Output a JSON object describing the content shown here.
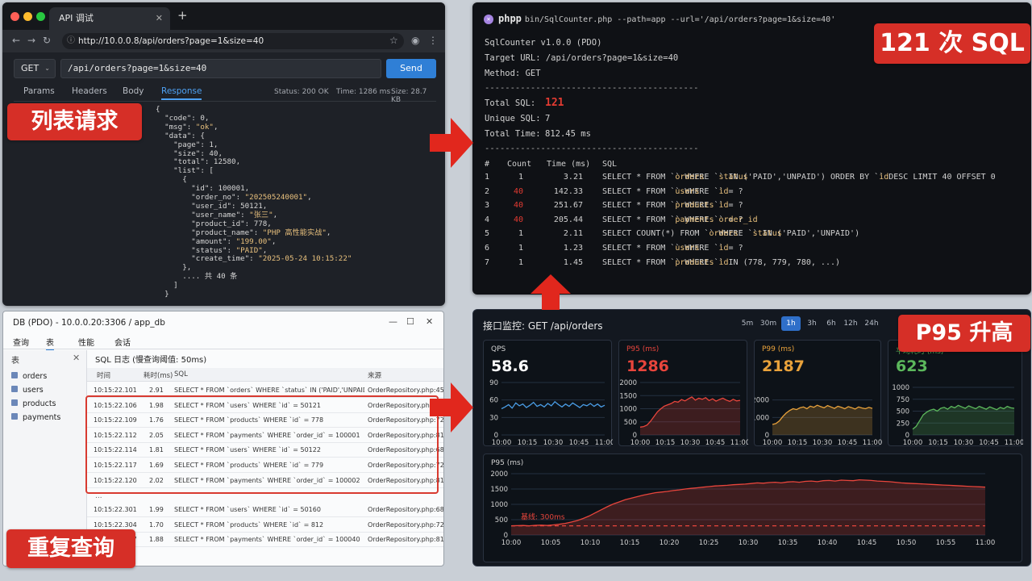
{
  "browser": {
    "tab_title": "API 调试",
    "url": "http://10.0.0.8/api/orders?page=1&size=40",
    "method": "GET",
    "path": "/api/orders?page=1&size=40",
    "send_label": "Send",
    "tabs": [
      "Params",
      "Headers",
      "Body",
      "Response"
    ],
    "active_tab": "Response",
    "status": "Status: 200 OK",
    "time": "Time: 1286 ms",
    "size": "Size: 28.7 KB",
    "response_lines": [
      "{",
      "  \"code\": 0,",
      "  \"msg\": \"ok\",",
      "  \"data\": {",
      "    \"page\": 1,",
      "    \"size\": 40,",
      "    \"total\": 12580,",
      "    \"list\": [",
      "      {",
      "        \"id\": 100001,",
      "        \"order_no\": \"202505240001\",",
      "        \"user_id\": 50121,",
      "        \"user_name\": \"张三\",",
      "        \"product_id\": 778,",
      "        \"product_name\": \"PHP 高性能实战\",",
      "        \"amount\": \"199.00\",",
      "        \"status\": \"PAID\",",
      "        \"create_time\": \"2025-05-24 10:15:22\"",
      "      },",
      "      .... 共 40 条",
      "    ]",
      "  }"
    ]
  },
  "callouts": {
    "list_request": "列表请求",
    "sql_count": "121 次 SQL",
    "p95_rise": "P95 升高",
    "repeat_query": "重复查询"
  },
  "terminal": {
    "cmd_name": "phpp",
    "command": "bin/SqlCounter.php --path=app --url='/api/orders?page=1&size=40'",
    "version": "SqlCounter v1.0.0 (PDO)",
    "target": "Target URL: /api/orders?page=1&size=40",
    "method": "Method: GET",
    "divider": "------------------------------------------",
    "total_sql_label": "Total SQL:",
    "total_sql": "121",
    "unique_sql_label": "Unique SQL:",
    "unique_sql": "7",
    "total_time_label": "Total Time:",
    "total_time": "812.45 ms",
    "headers": [
      "#",
      "Count",
      "Time (ms)",
      "SQL"
    ],
    "rows": [
      {
        "n": "1",
        "count": "1",
        "time": "3.21",
        "sql": "SELECT * FROM `orders` WHERE `status` IN ('PAID','UNPAID') ORDER BY `id` DESC LIMIT 40 OFFSET 0",
        "hot": false
      },
      {
        "n": "2",
        "count": "40",
        "time": "142.33",
        "sql": "SELECT * FROM `users` WHERE `id` = ?",
        "hot": true
      },
      {
        "n": "3",
        "count": "40",
        "time": "251.67",
        "sql": "SELECT * FROM `products` WHERE `id` = ?",
        "hot": true
      },
      {
        "n": "4",
        "count": "40",
        "time": "205.44",
        "sql": "SELECT * FROM `payments` WHERE `order_id` = ?",
        "hot": true
      },
      {
        "n": "5",
        "count": "1",
        "time": "2.11",
        "sql": "SELECT COUNT(*) FROM `orders` WHERE `status` IN ('PAID','UNPAID')",
        "hot": false
      },
      {
        "n": "6",
        "count": "1",
        "time": "1.23",
        "sql": "SELECT * FROM `users` WHERE `id` = ?",
        "hot": false
      },
      {
        "n": "7",
        "count": "1",
        "time": "1.45",
        "sql": "SELECT * FROM `products` WHERE `id` IN (778, 779, 780, ...)",
        "hot": false
      }
    ]
  },
  "db": {
    "title": "DB (PDO)  -  10.0.0.20:3306 / app_db",
    "menu": [
      "查询",
      "表",
      "性能",
      "会话"
    ],
    "active_menu": "表",
    "side_header": "表",
    "tables": [
      "orders",
      "users",
      "products",
      "payments"
    ],
    "log_header": "SQL 日志 (慢查询阈值: 50ms)",
    "columns": [
      "时间",
      "耗时(ms)",
      "SQL",
      "来源"
    ],
    "rows_top": [
      {
        "t": "10:15:22.101",
        "ms": "2.91",
        "sql": "SELECT * FROM `orders` WHERE `status` IN ('PAID','UNPAID') ORDER BY",
        "src": "OrderRepository.php:45"
      },
      {
        "t": "10:15:22.106",
        "ms": "1.98",
        "sql": "SELECT * FROM `users` WHERE `id` = 50121",
        "src": "OrderRepository.php:68"
      },
      {
        "t": "10:15:22.109",
        "ms": "1.76",
        "sql": "SELECT * FROM `products` WHERE `id` = 778",
        "src": "OrderRepository.php:72"
      },
      {
        "t": "10:15:22.112",
        "ms": "2.05",
        "sql": "SELECT * FROM `payments` WHERE `order_id` = 100001",
        "src": "OrderRepository.php:81"
      },
      {
        "t": "10:15:22.114",
        "ms": "1.81",
        "sql": "SELECT * FROM `users` WHERE `id` = 50122",
        "src": "OrderRepository.php:68"
      },
      {
        "t": "10:15:22.117",
        "ms": "1.69",
        "sql": "SELECT * FROM `products` WHERE `id` = 779",
        "src": "OrderRepository.php:72"
      },
      {
        "t": "10:15:22.120",
        "ms": "2.02",
        "sql": "SELECT * FROM `payments` WHERE `order_id` = 100002",
        "src": "OrderRepository.php:81"
      }
    ],
    "ellipsis": "...",
    "rows_bottom": [
      {
        "t": "10:15:22.301",
        "ms": "1.99",
        "sql": "SELECT * FROM `users` WHERE `id` = 50160",
        "src": "OrderRepository.php:68"
      },
      {
        "t": "10:15:22.304",
        "ms": "1.70",
        "sql": "SELECT * FROM `products` WHERE `id` = 812",
        "src": "OrderRepository.php:72"
      },
      {
        "t": "10:15:22.307",
        "ms": "1.88",
        "sql": "SELECT * FROM `payments` WHERE `order_id` = 100040",
        "src": "OrderRepository.php:81"
      }
    ]
  },
  "monitor": {
    "title": "接口监控: GET /api/orders",
    "ranges": [
      "5m",
      "30m",
      "1h",
      "3h",
      "6h",
      "12h",
      "24h"
    ],
    "active_range": "1h",
    "colors": {
      "qps": "#4a9de6",
      "p95": "#e8453c",
      "p99": "#e9a23b",
      "avg": "#5cb85c"
    }
  },
  "chart_data": [
    {
      "type": "line",
      "title": "QPS",
      "value": "58.6",
      "ylim": [
        0,
        90
      ],
      "yticks": [
        0,
        30,
        60,
        90
      ],
      "xticks": [
        "10:00",
        "10:15",
        "10:30",
        "10:45",
        "11:00"
      ],
      "series": [
        {
          "values": [
            45,
            48,
            52,
            46,
            55,
            50,
            53,
            47,
            51,
            56,
            49,
            52,
            48,
            54,
            50,
            57,
            52,
            48,
            53,
            49,
            55,
            51,
            47,
            52,
            50,
            54,
            49,
            53,
            48,
            51
          ]
        }
      ]
    },
    {
      "type": "area",
      "title": "P95 (ms)",
      "value": "1286",
      "ylim": [
        0,
        2000
      ],
      "yticks": [
        0,
        500,
        1000,
        1500,
        2000
      ],
      "xticks": [
        "10:00",
        "10:15",
        "10:30",
        "10:45",
        "11:00"
      ],
      "series": [
        {
          "values": [
            300,
            320,
            380,
            520,
            700,
            880,
            1000,
            1100,
            1150,
            1200,
            1280,
            1250,
            1350,
            1300,
            1380,
            1450,
            1330,
            1400,
            1360,
            1420,
            1310,
            1380,
            1290,
            1350,
            1400,
            1330,
            1280,
            1360,
            1300,
            1320
          ]
        }
      ]
    },
    {
      "type": "area",
      "title": "P99 (ms)",
      "value": "2187",
      "ylim": [
        0,
        3000
      ],
      "yticks": [
        0,
        1000,
        2000
      ],
      "xticks": [
        "10:00",
        "10:15",
        "10:30",
        "10:45",
        "11:00"
      ],
      "series": [
        {
          "values": [
            600,
            650,
            800,
            1050,
            1250,
            1400,
            1500,
            1450,
            1550,
            1600,
            1500,
            1650,
            1580,
            1700,
            1620,
            1550,
            1680,
            1600,
            1520,
            1640,
            1580,
            1500,
            1620,
            1560,
            1480,
            1600,
            1540,
            1500,
            1580,
            1520
          ]
        }
      ]
    },
    {
      "type": "area",
      "title": "平均耗时 (ms)",
      "value": "623",
      "ylim": [
        0,
        1000
      ],
      "yticks": [
        0,
        250,
        500,
        750,
        1000
      ],
      "xticks": [
        "10:00",
        "10:15",
        "10:30",
        "10:45",
        "11:00"
      ],
      "series": [
        {
          "values": [
            120,
            180,
            300,
            420,
            480,
            520,
            540,
            500,
            560,
            580,
            540,
            600,
            570,
            620,
            590,
            560,
            610,
            580,
            550,
            600,
            570,
            540,
            590,
            560,
            530,
            580,
            550,
            600,
            570,
            560
          ]
        }
      ]
    },
    {
      "type": "area",
      "title": "P95 (ms)",
      "ylim": [
        0,
        2000
      ],
      "yticks": [
        0,
        500,
        1000,
        1500,
        2000
      ],
      "xticks": [
        "10:00",
        "10:05",
        "10:10",
        "10:15",
        "10:20",
        "10:25",
        "10:30",
        "10:35",
        "10:40",
        "10:45",
        "10:50",
        "10:55",
        "11:00"
      ],
      "baseline": 300,
      "baseline_label": "基线: 300ms",
      "series": [
        {
          "values": [
            300,
            305,
            310,
            300,
            315,
            320,
            310,
            330,
            350,
            380,
            420,
            470,
            540,
            620,
            720,
            820,
            920,
            1010,
            1080,
            1150,
            1200,
            1250,
            1300,
            1340,
            1380,
            1400,
            1420,
            1450,
            1470,
            1500,
            1520,
            1540,
            1560,
            1580,
            1600,
            1610,
            1620,
            1640,
            1650,
            1660,
            1680,
            1700,
            1690,
            1710,
            1720,
            1700,
            1730,
            1740,
            1720,
            1750,
            1760,
            1740,
            1770,
            1780,
            1760,
            1790,
            1780,
            1770,
            1800,
            1790,
            1780,
            1760,
            1750,
            1740,
            1720,
            1700,
            1690,
            1680,
            1670,
            1660,
            1650,
            1640,
            1630,
            1620,
            1610,
            1600,
            1590,
            1580,
            1570,
            1560
          ]
        }
      ]
    }
  ]
}
